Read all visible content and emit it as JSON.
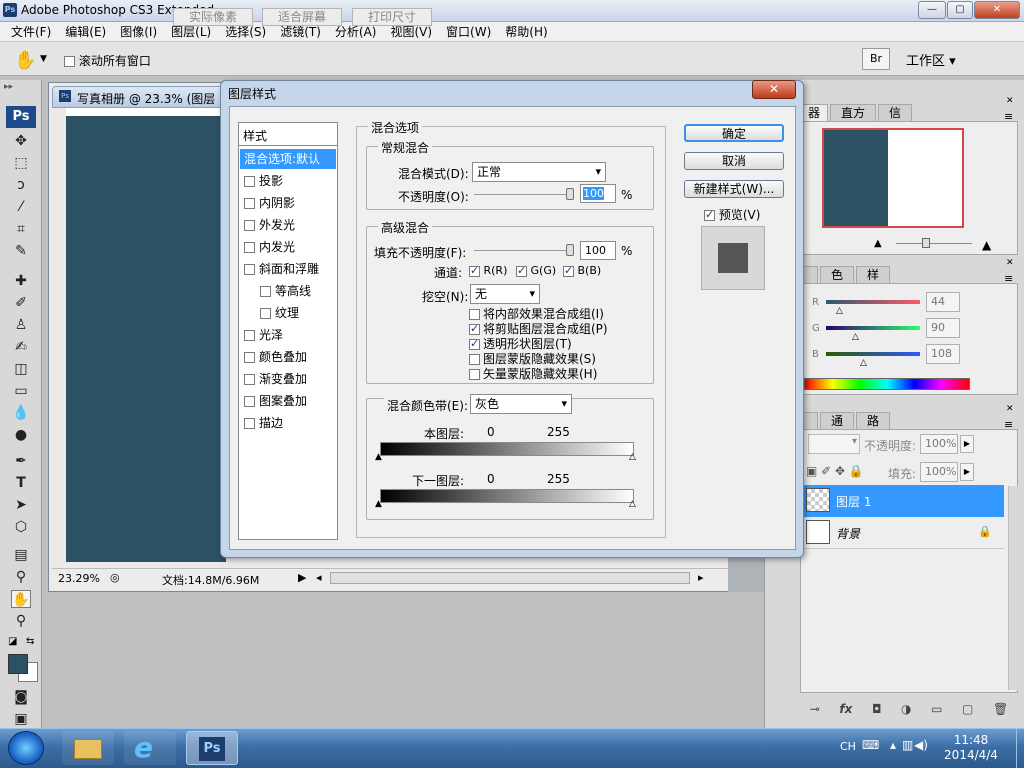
{
  "app": {
    "title": "Adobe Photoshop CS3 Extended",
    "ps_badge": "Ps",
    "window_buttons": [
      "—",
      "▢",
      "✕"
    ]
  },
  "menu": [
    "文件(F)",
    "编辑(E)",
    "图像(I)",
    "图层(L)",
    "选择(S)",
    "滤镜(T)",
    "分析(A)",
    "视图(V)",
    "窗口(W)",
    "帮助(H)"
  ],
  "options_bar": {
    "scroll_all": "滚动所有窗口",
    "actual_pixels": "实际像素",
    "fit_screen": "适合屏幕",
    "print_size": "打印尺寸",
    "workspace": "工作区 ▾"
  },
  "tools": {
    "logo": "Ps"
  },
  "document": {
    "tab_title": "写真相册 @ 23.3% (图层",
    "zoom": "23.29%",
    "doc_info": "文档:14.8M/6.96M",
    "canvas_color": "#2b5162"
  },
  "dialog": {
    "title": "图层样式",
    "close": "✕",
    "style_header": "样式",
    "styles": [
      {
        "label": "混合选项:默认",
        "selected": true,
        "checkbox": false,
        "indent": false
      },
      {
        "label": "投影",
        "checkbox": true,
        "indent": false
      },
      {
        "label": "内阴影",
        "checkbox": true,
        "indent": false
      },
      {
        "label": "外发光",
        "checkbox": true,
        "indent": false
      },
      {
        "label": "内发光",
        "checkbox": true,
        "indent": false
      },
      {
        "label": "斜面和浮雕",
        "checkbox": true,
        "indent": false
      },
      {
        "label": "等高线",
        "checkbox": true,
        "indent": true
      },
      {
        "label": "纹理",
        "checkbox": true,
        "indent": true
      },
      {
        "label": "光泽",
        "checkbox": true,
        "indent": false
      },
      {
        "label": "颜色叠加",
        "checkbox": true,
        "indent": false
      },
      {
        "label": "渐变叠加",
        "checkbox": true,
        "indent": false
      },
      {
        "label": "图案叠加",
        "checkbox": true,
        "indent": false
      },
      {
        "label": "描边",
        "checkbox": true,
        "indent": false
      }
    ],
    "blend_options": "混合选项",
    "general_blend": "常规混合",
    "blend_mode_label": "混合模式(D):",
    "blend_mode_value": "正常",
    "opacity_label": "不透明度(O):",
    "opacity_value": "100",
    "percent": "%",
    "advanced_blend": "高级混合",
    "fill_opacity_label": "填充不透明度(F):",
    "fill_opacity_value": "100",
    "channels_label": "通道:",
    "channel_r": "R(R)",
    "channel_g": "G(G)",
    "channel_b": "B(B)",
    "knockout_label": "挖空(N):",
    "knockout_value": "无",
    "options": [
      {
        "label": "将内部效果混合成组(I)",
        "checked": false
      },
      {
        "label": "将剪贴图层混合成组(P)",
        "checked": true
      },
      {
        "label": "透明形状图层(T)",
        "checked": true
      },
      {
        "label": "图层蒙版隐藏效果(S)",
        "checked": false
      },
      {
        "label": "矢量蒙版隐藏效果(H)",
        "checked": false
      }
    ],
    "blend_if_label": "混合颜色带(E):",
    "blend_if_value": "灰色",
    "this_layer_label": "本图层:",
    "this_layer_min": "0",
    "this_layer_max": "255",
    "underlying_label": "下一图层:",
    "underlying_min": "0",
    "underlying_max": "255",
    "ok": "确定",
    "cancel": "取消",
    "new_style": "新建样式(W)...",
    "preview": "预览(V)"
  },
  "panels": {
    "tabs_top": [
      "器",
      "直方图",
      "信息"
    ],
    "tabs_color": [
      "色板",
      "样式"
    ],
    "color_r": "44",
    "color_g": "90",
    "color_b": "108",
    "label_r": "R",
    "label_g": "G",
    "label_b": "B",
    "tabs_layers": [
      "通道",
      "路径"
    ],
    "opacity_label": "不透明度:",
    "opacity_value": "100%",
    "fill_label": "填充:",
    "fill_value": "100%",
    "layers": [
      {
        "name": "图层 1",
        "selected": true
      },
      {
        "name": "背景",
        "selected": false
      }
    ],
    "swatch_color": "#2b5162"
  },
  "taskbar": {
    "lang": "CH",
    "time": "11:48",
    "date": "2014/4/4",
    "ps_app": "Ps"
  }
}
